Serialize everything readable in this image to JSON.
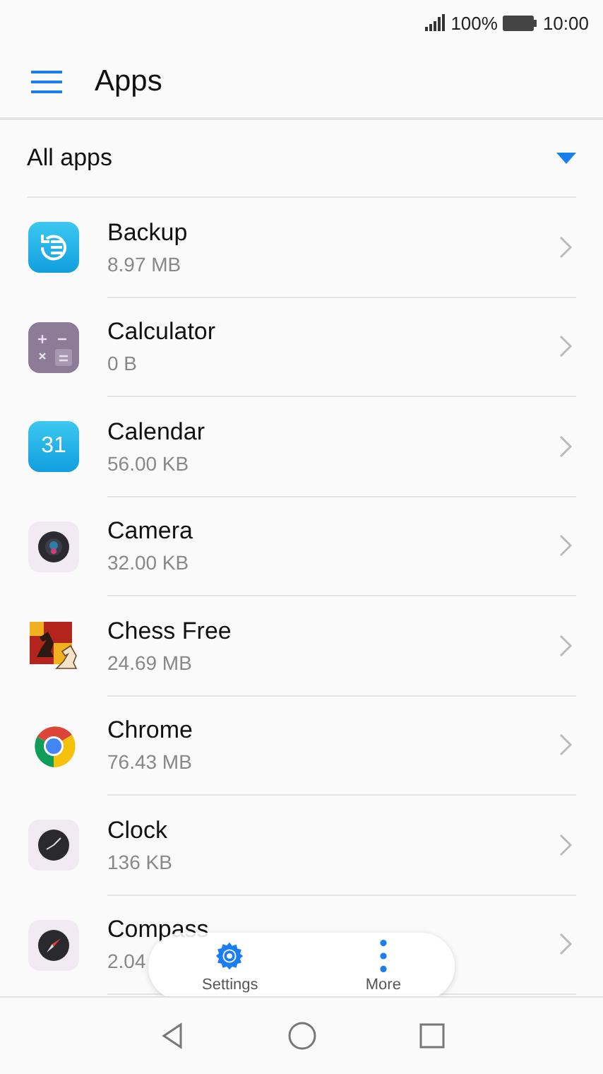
{
  "status_bar": {
    "battery": "100%",
    "time": "10:00"
  },
  "app_bar": {
    "title": "Apps"
  },
  "filter": {
    "label": "All apps"
  },
  "apps": [
    {
      "kind": "backup",
      "name": "Backup",
      "size": "8.97 MB"
    },
    {
      "kind": "calculator",
      "name": "Calculator",
      "size": "0 B"
    },
    {
      "kind": "calendar",
      "name": "Calendar",
      "size": "56.00 KB",
      "icon_text": "31"
    },
    {
      "kind": "camera",
      "name": "Camera",
      "size": "32.00 KB"
    },
    {
      "kind": "chess",
      "name": "Chess Free",
      "size": "24.69 MB"
    },
    {
      "kind": "chrome",
      "name": "Chrome",
      "size": "76.43 MB"
    },
    {
      "kind": "clock",
      "name": "Clock",
      "size": "136 KB"
    },
    {
      "kind": "compass",
      "name": "Compass",
      "size": "2.04"
    }
  ],
  "floating_bar": [
    {
      "kind": "settings",
      "label": "Settings"
    },
    {
      "kind": "more",
      "label": "More"
    }
  ]
}
